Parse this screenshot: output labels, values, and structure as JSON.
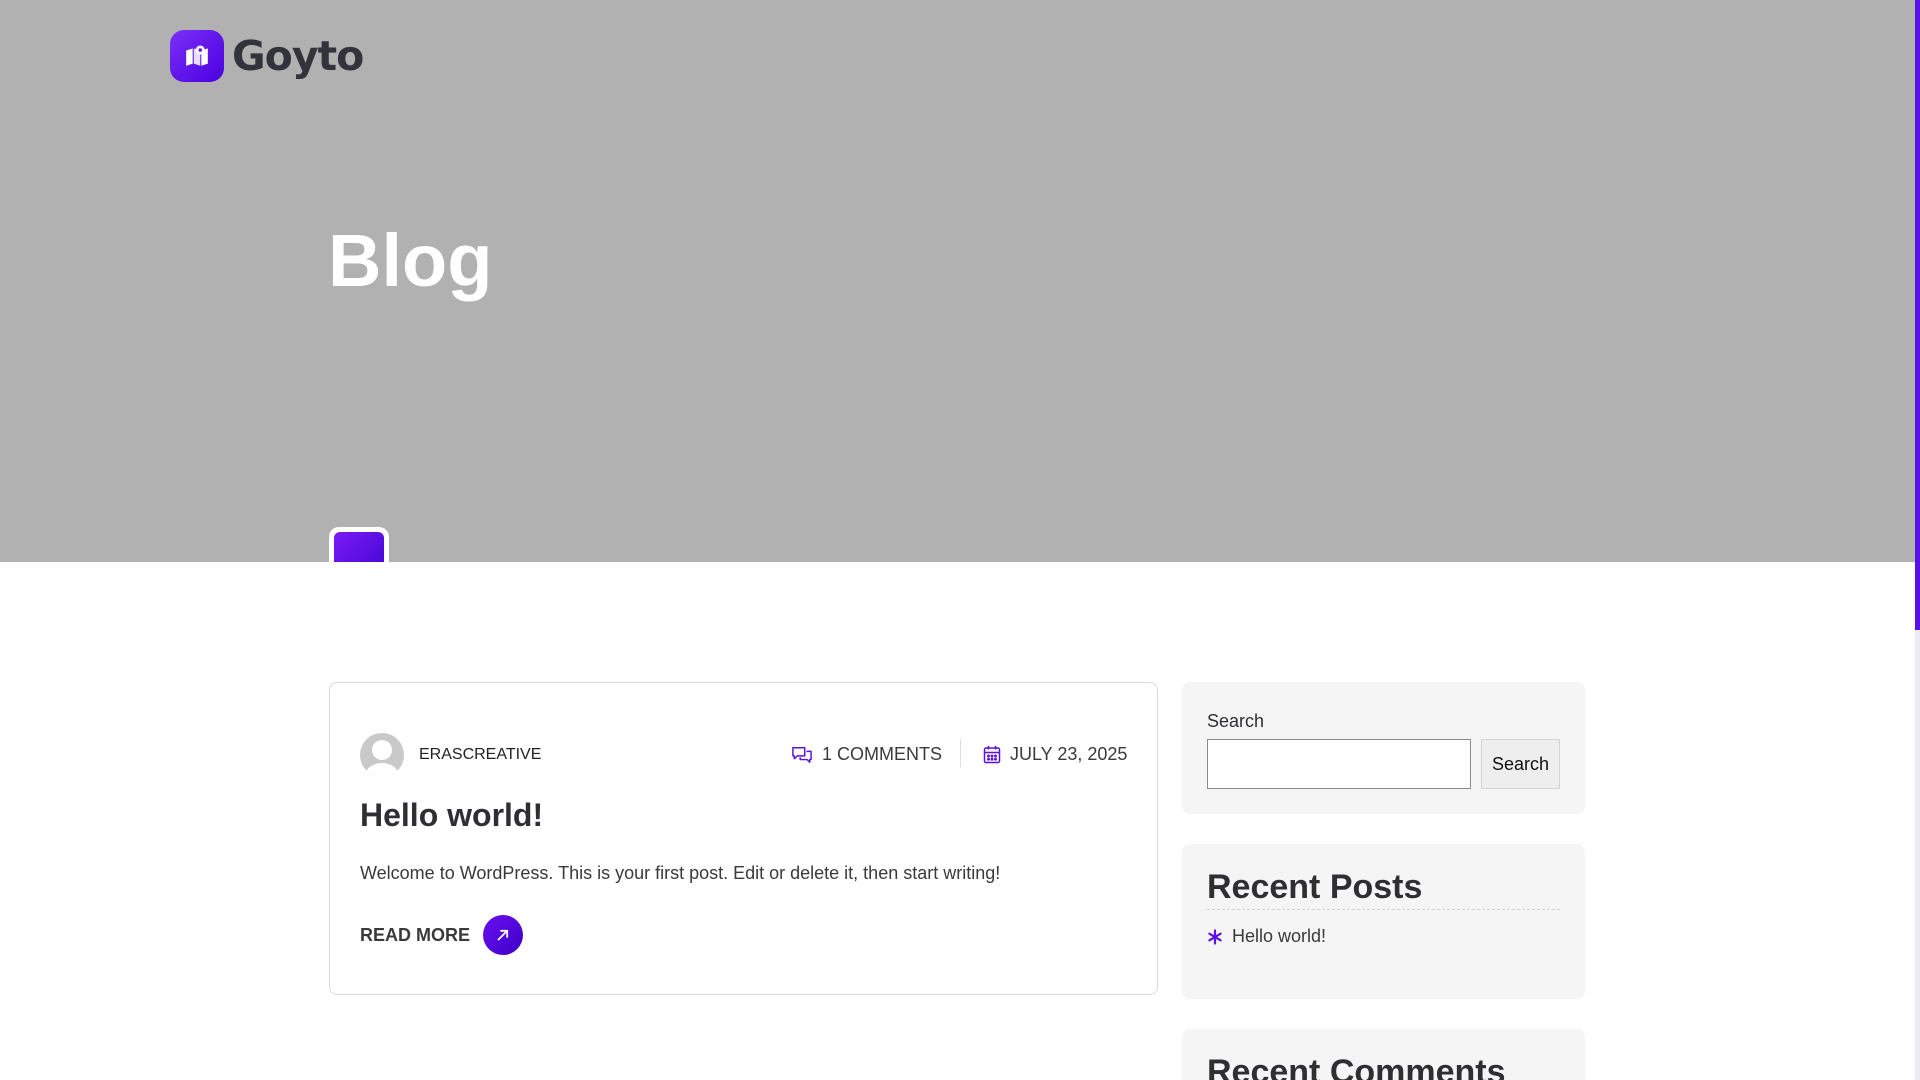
{
  "brand": {
    "name": "Goyto",
    "accent": "#5a10e6"
  },
  "hero": {
    "title": "Blog",
    "background": "#b1b1b1"
  },
  "post": {
    "author": "ERASCREATIVE",
    "comments": "1 COMMENTS",
    "date": "JULY 23, 2025",
    "title": "Hello world!",
    "excerpt": "Welcome to WordPress. This is your first post. Edit or delete it, then start writing!",
    "read_more": "READ MORE",
    "icons": {
      "comments": "comments-icon",
      "date": "calendar-icon",
      "read_more": "arrow-up-right-icon"
    }
  },
  "sidebar": {
    "search": {
      "label": "Search",
      "value": "",
      "button": "Search"
    },
    "recent_posts": {
      "title": "Recent Posts",
      "items": [
        {
          "label": "Hello world!",
          "icon": "asterisk-icon"
        }
      ]
    },
    "recent_comments": {
      "title": "Recent Comments"
    }
  }
}
